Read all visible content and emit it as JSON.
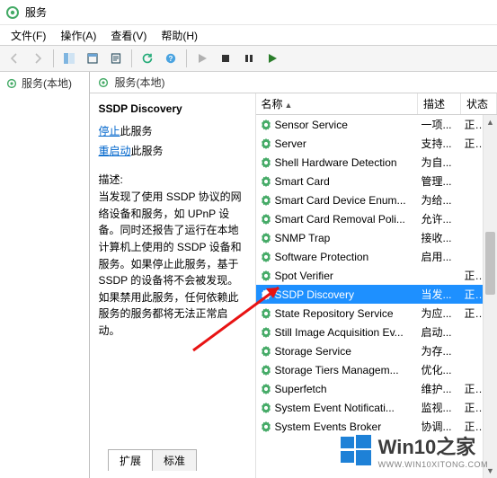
{
  "window": {
    "title": "服务"
  },
  "menu": {
    "file": "文件(F)",
    "action": "操作(A)",
    "view": "查看(V)",
    "help": "帮助(H)"
  },
  "sidebar": {
    "root_label": "服务(本地)"
  },
  "right_header": {
    "label": "服务(本地)"
  },
  "detail": {
    "title": "SSDP Discovery",
    "stop_label": "停止",
    "stop_suffix": "此服务",
    "restart_label": "重启动",
    "restart_suffix": "此服务",
    "desc_label": "描述:",
    "desc_text": "当发现了使用 SSDP 协议的网络设备和服务，如 UPnP 设备。同时还报告了运行在本地计算机上使用的 SSDP 设备和服务。如果停止此服务，基于 SSDP 的设备将不会被发现。如果禁用此服务，任何依赖此服务的服务都将无法正常启动。"
  },
  "columns": {
    "name": "名称",
    "desc": "描述",
    "status": "状态"
  },
  "services": [
    {
      "name": "Sensor Service",
      "desc": "一项...",
      "status": "正在..."
    },
    {
      "name": "Server",
      "desc": "支持...",
      "status": "正在..."
    },
    {
      "name": "Shell Hardware Detection",
      "desc": "为自...",
      "status": ""
    },
    {
      "name": "Smart Card",
      "desc": "管理...",
      "status": ""
    },
    {
      "name": "Smart Card Device Enum...",
      "desc": "为给...",
      "status": ""
    },
    {
      "name": "Smart Card Removal Poli...",
      "desc": "允许...",
      "status": ""
    },
    {
      "name": "SNMP Trap",
      "desc": "接收...",
      "status": ""
    },
    {
      "name": "Software Protection",
      "desc": "启用...",
      "status": ""
    },
    {
      "name": "Spot Verifier",
      "desc": "",
      "status": "正在..."
    },
    {
      "name": "SSDP Discovery",
      "desc": "当发...",
      "status": "正在...",
      "selected": true
    },
    {
      "name": "State Repository Service",
      "desc": "为应...",
      "status": "正在..."
    },
    {
      "name": "Still Image Acquisition Ev...",
      "desc": "启动...",
      "status": ""
    },
    {
      "name": "Storage Service",
      "desc": "为存...",
      "status": ""
    },
    {
      "name": "Storage Tiers Managem...",
      "desc": "优化...",
      "status": ""
    },
    {
      "name": "Superfetch",
      "desc": "维护...",
      "status": "正在..."
    },
    {
      "name": "System Event Notificati...",
      "desc": "监视...",
      "status": "正在..."
    },
    {
      "name": "System Events Broker",
      "desc": "协调...",
      "status": "正在..."
    }
  ],
  "tabs": {
    "extended": "扩展",
    "standard": "标准"
  },
  "watermark": {
    "text": "Win10之家",
    "subtext": "WWW.WIN10XITONG.COM"
  },
  "colors": {
    "accent": "#1e90ff",
    "link": "#0066cc"
  }
}
